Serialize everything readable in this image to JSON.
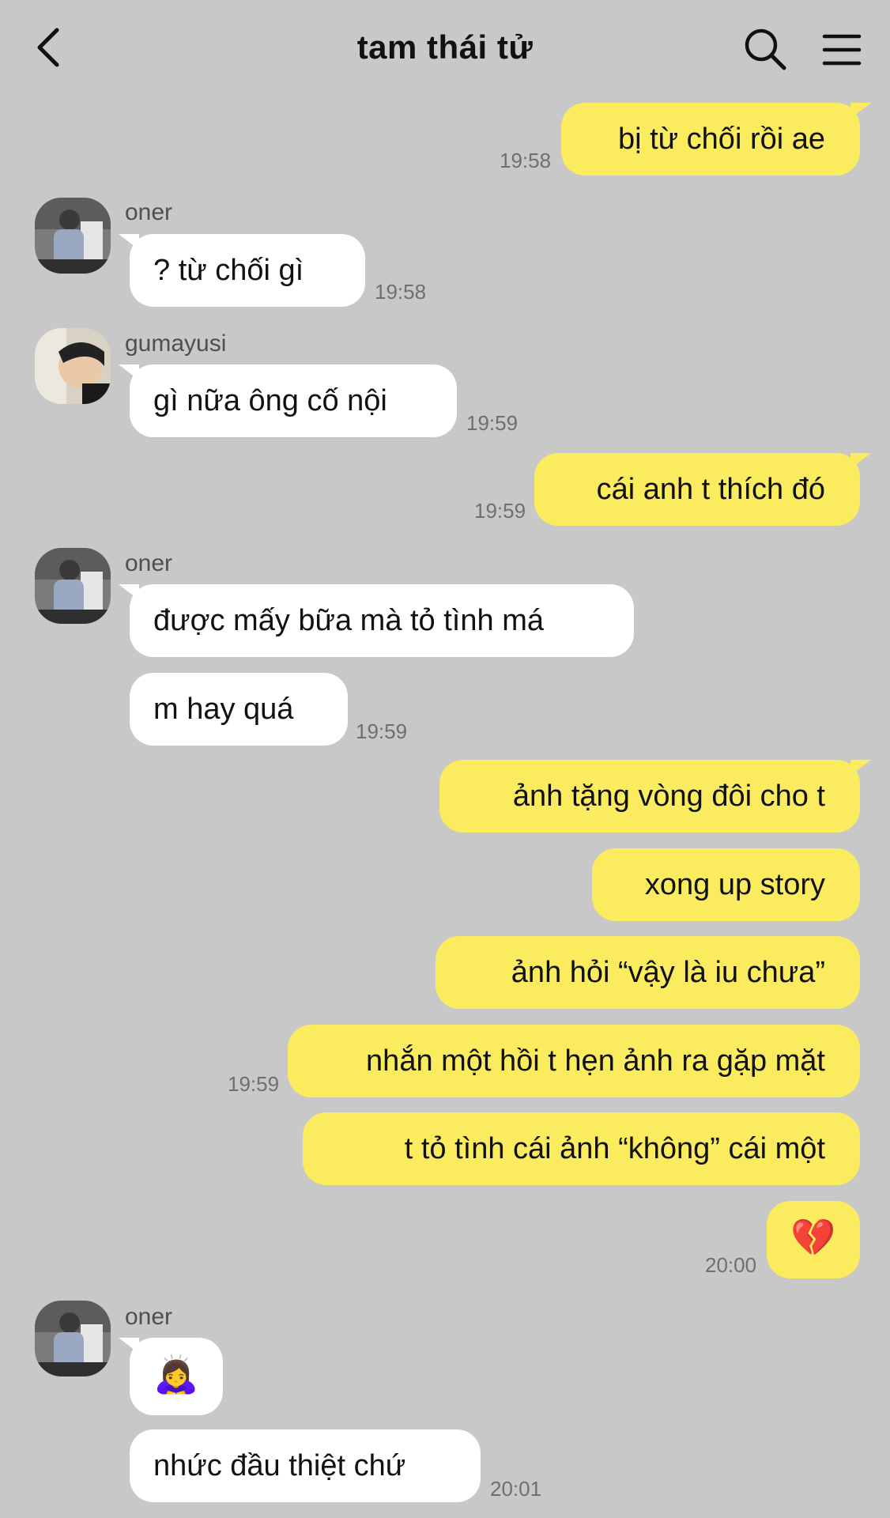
{
  "header": {
    "title": "tam thái tử",
    "back_icon": "chevron-left-icon",
    "search_icon": "search-icon",
    "menu_icon": "hamburger-menu-icon"
  },
  "colors": {
    "background": "#c8c8c8",
    "my_bubble": "#fbec5f",
    "their_bubble": "#ffffff"
  },
  "messages": [
    {
      "sender": "me",
      "text": "bị từ chối rồi ae",
      "time": "19:58"
    },
    {
      "sender": "oner",
      "name": "oner",
      "text": "? từ chối gì",
      "time": "19:58"
    },
    {
      "sender": "gumayusi",
      "name": "gumayusi",
      "text": "gì nữa ông cố nội",
      "time": "19:59"
    },
    {
      "sender": "me",
      "text": "cái anh t thích đó",
      "time": "19:59"
    },
    {
      "sender": "oner",
      "name": "oner",
      "text": "được mấy bữa mà tỏ tình má",
      "time": ""
    },
    {
      "sender": "oner",
      "text": "m hay quá",
      "time": "19:59"
    },
    {
      "sender": "me",
      "text": "ảnh tặng vòng đôi cho t",
      "time": ""
    },
    {
      "sender": "me",
      "text": "xong up story",
      "time": ""
    },
    {
      "sender": "me",
      "text": "ảnh hỏi “vậy là iu chưa”",
      "time": ""
    },
    {
      "sender": "me",
      "text": "nhắn một hồi t hẹn ảnh ra gặp mặt",
      "time": "19:59"
    },
    {
      "sender": "me",
      "text": "t tỏ tình cái ảnh “không” cái một",
      "time": ""
    },
    {
      "sender": "me",
      "text": "💔",
      "time": "20:00"
    },
    {
      "sender": "oner",
      "name": "oner",
      "text": "🙇‍♀️",
      "time": ""
    },
    {
      "sender": "oner",
      "text": "nhức đầu thiệt chứ",
      "time": "20:01"
    }
  ]
}
